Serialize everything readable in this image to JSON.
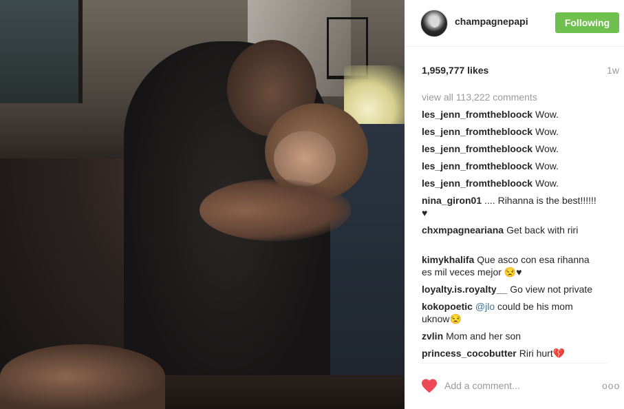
{
  "post": {
    "username": "champagnepapi",
    "follow_label": "Following",
    "likes": "1,959,777 likes",
    "time_ago": "1w",
    "view_all": "view all 113,222 comments"
  },
  "comments": [
    {
      "user": "les_jenn_fromthebloock",
      "text": "Wow."
    },
    {
      "user": "les_jenn_fromthebloock",
      "text": "Wow."
    },
    {
      "user": "les_jenn_fromthebloock",
      "text": "Wow."
    },
    {
      "user": "les_jenn_fromthebloock",
      "text": "Wow."
    },
    {
      "user": "les_jenn_fromthebloock",
      "text": "Wow."
    },
    {
      "user": "nina_giron01",
      "text": ".... Rihanna is the best!!!!!! ♥"
    },
    {
      "user": "chxmpagneariana",
      "text": "Get back with riri"
    },
    {
      "user": "kimykhalifa",
      "text": "Que asco con esa rihanna es mil veces mejor 😒♥"
    },
    {
      "user": "loyalty.is.royalty__",
      "text": "Go view not private"
    },
    {
      "user": "kokopoetic",
      "mention": "@jlo",
      "text": " could be his mom uknow😒"
    },
    {
      "user": "zvlin",
      "text": "Mom and her son"
    },
    {
      "user": "princess_cocobutter",
      "text": "Riri hurt💔"
    }
  ],
  "footer": {
    "comment_placeholder": "Add a comment...",
    "more_label": "ooo"
  },
  "icons": {
    "like": "heart-icon",
    "more": "more-options-icon"
  },
  "colors": {
    "follow_button": "#70c050",
    "like_heart": "#ed4956",
    "mention": "#3f729b",
    "muted_text": "#999999"
  }
}
